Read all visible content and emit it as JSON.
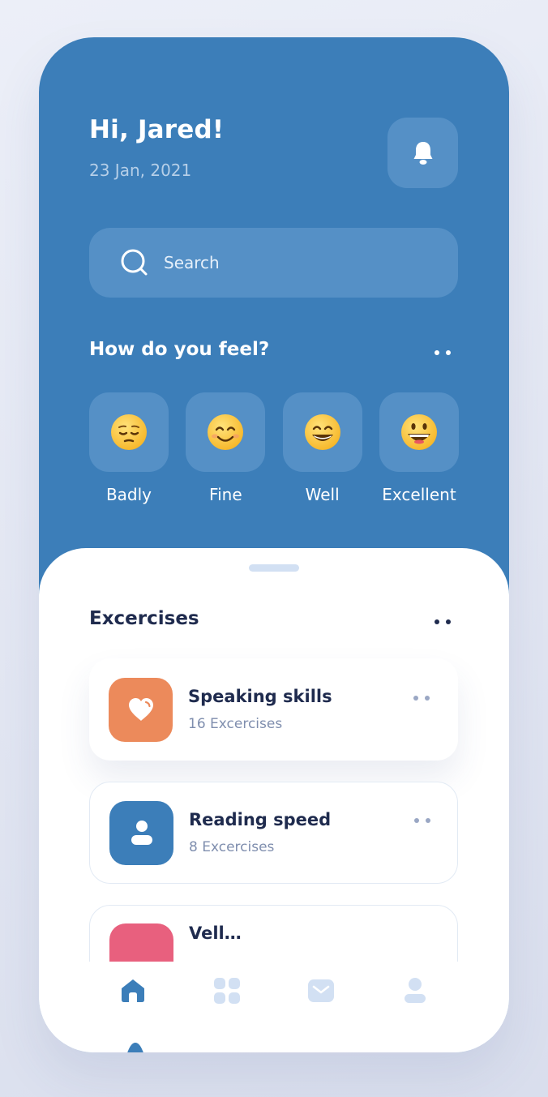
{
  "header": {
    "greeting": "Hi, Jared!",
    "date": "23 Jan, 2021",
    "notification_icon": "bell-icon"
  },
  "search": {
    "placeholder": "Search",
    "icon": "search-icon"
  },
  "feel": {
    "title": "How do you feel?",
    "moods": [
      {
        "label": "Badly",
        "emoji": "😔"
      },
      {
        "label": "Fine",
        "emoji": "😊"
      },
      {
        "label": "Well",
        "emoji": "😁"
      },
      {
        "label": "Excellent",
        "emoji": "😃"
      }
    ]
  },
  "exercises": {
    "title": "Excercises",
    "items": [
      {
        "name": "Speaking skills",
        "count": "16 Excercises",
        "icon": "heart-icon",
        "color": "#ec8a5b"
      },
      {
        "name": "Reading speed",
        "count": "8 Excercises",
        "icon": "person-icon",
        "color": "#3c7eb9"
      },
      {
        "name": "Vell…",
        "count": "",
        "icon": "",
        "color": "#e8607e"
      }
    ]
  },
  "nav": {
    "items": [
      {
        "icon": "home-icon",
        "active": true
      },
      {
        "icon": "grid-icon",
        "active": false
      },
      {
        "icon": "mail-icon",
        "active": false
      },
      {
        "icon": "user-icon",
        "active": false
      }
    ]
  },
  "colors": {
    "primary": "#3c7eb9",
    "primary_light": "#5590c6",
    "dark_text": "#1f2b4e",
    "muted_text": "#7f8eae",
    "accent_orange": "#ec8a5b",
    "accent_pink": "#e8607e",
    "nav_inactive": "#d2e0f3"
  }
}
